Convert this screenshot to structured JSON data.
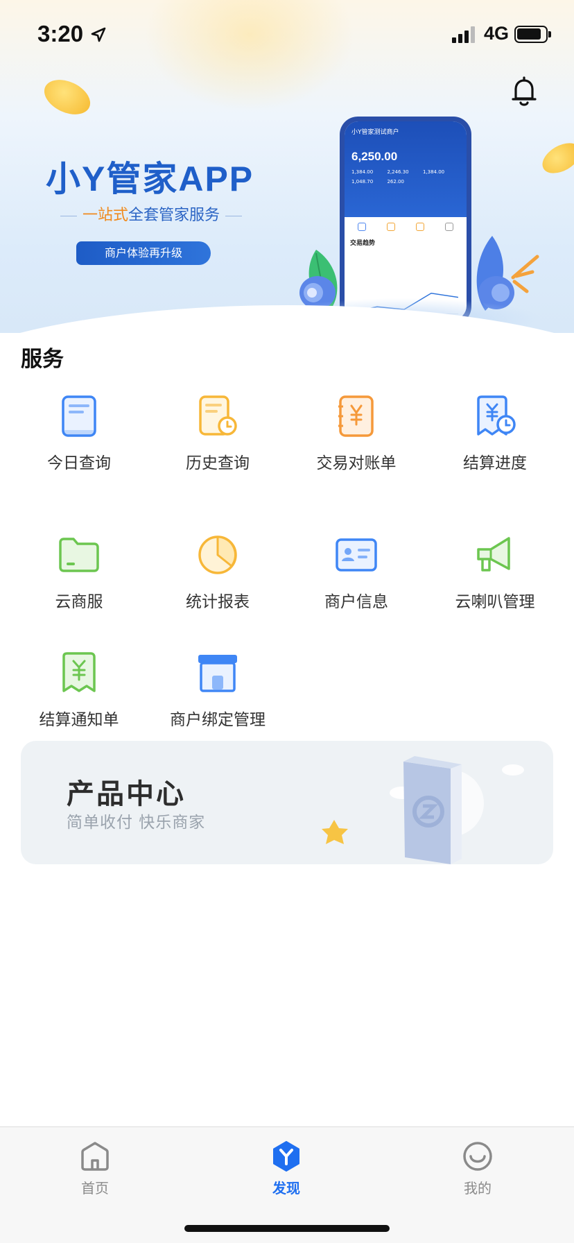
{
  "status_bar": {
    "time": "3:20",
    "network": "4G"
  },
  "banner": {
    "title": "小Y管家APP",
    "subtitle_highlight": "一站式",
    "subtitle_rest": "全套管家服务",
    "pill": "商户体验再升级",
    "phone_title": "小Y管家测试商户",
    "phone_amount": "6,250.00",
    "phone_stats": [
      "1,384.00",
      "2,246.30",
      "1,384.00",
      "1,048.70",
      "262.00"
    ],
    "phone_section": "交易趋势"
  },
  "services": {
    "title": "服务",
    "items": [
      {
        "label": "今日查询",
        "icon": "document-icon"
      },
      {
        "label": "历史查询",
        "icon": "history-icon"
      },
      {
        "label": "交易对账单",
        "icon": "yuan-ledger-icon"
      },
      {
        "label": "结算进度",
        "icon": "settlement-progress-icon"
      },
      {
        "label": "云商服",
        "icon": "folder-icon"
      },
      {
        "label": "统计报表",
        "icon": "pie-chart-icon"
      },
      {
        "label": "商户信息",
        "icon": "id-card-icon"
      },
      {
        "label": "云喇叭管理",
        "icon": "megaphone-icon"
      },
      {
        "label": "结算通知单",
        "icon": "yuan-receipt-icon"
      },
      {
        "label": "商户绑定管理",
        "icon": "store-icon"
      }
    ]
  },
  "product_center": {
    "title": "产品中心",
    "subtitle": "简单收付 快乐商家"
  },
  "tab_bar": {
    "items": [
      {
        "label": "首页",
        "icon": "home-icon",
        "active": false
      },
      {
        "label": "发现",
        "icon": "discover-icon",
        "active": true
      },
      {
        "label": "我的",
        "icon": "smile-icon",
        "active": false
      }
    ]
  },
  "colors": {
    "accent": "#1f6ff0",
    "brand_blue": "#1f5fc9",
    "highlight_orange": "#f08a1c"
  }
}
